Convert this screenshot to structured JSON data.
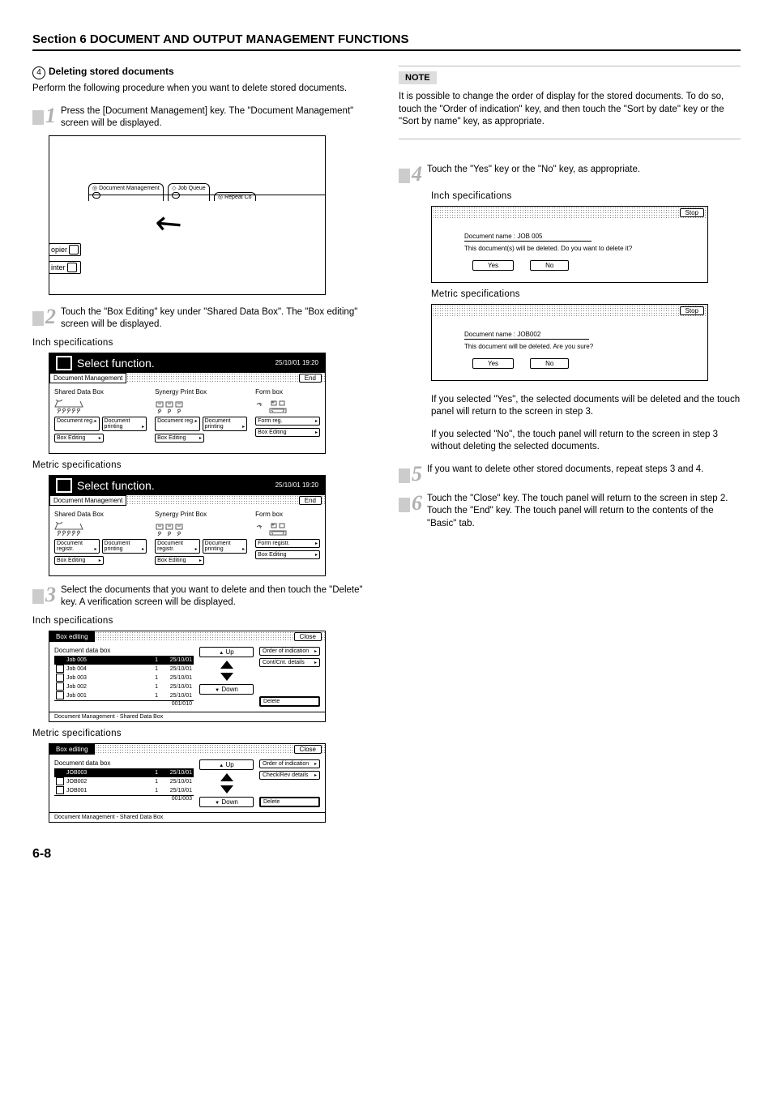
{
  "section_title": "Section 6  DOCUMENT AND OUTPUT MANAGEMENT FUNCTIONS",
  "circled_num": "4",
  "sub_heading": "Deleting stored documents",
  "intro": "Perform the following procedure when you want to delete stored documents.",
  "steps": {
    "s1": "Press the [Document Management] key. The \"Document Management\" screen will be displayed.",
    "s2": "Touch the \"Box Editing\" key under \"Shared Data Box\". The \"Box editing\" screen will be displayed.",
    "s3": "Select the documents that you want to delete and then touch the \"Delete\" key. A verification screen will be displayed.",
    "s4": "Touch the \"Yes\" key or the \"No\" key, as appropriate.",
    "s4b1": "If you selected \"Yes\", the selected documents will be deleted and the touch panel will return to the screen in step 3.",
    "s4b2": "If you selected \"No\", the touch panel will return to the screen in step 3 without deleting the selected documents.",
    "s5": "If you want to delete other stored documents, repeat steps 3 and 4.",
    "s6a": "Touch the \"Close\" key. The touch panel will return to the screen in step 2.",
    "s6b": "Touch the \"End\" key. The touch panel will return to the contents of the \"Basic\" tab."
  },
  "note": {
    "label": "NOTE",
    "text": "It is possible to change the order of display for the stored documents. To do so, touch the \"Order of indication\" key, and then touch the \"Sort by date\" key or the \"Sort by name\" key, as appropriate."
  },
  "labels": {
    "inch": "Inch specifications",
    "metric": "Metric specifications",
    "inch_sp": "Inch  specifications"
  },
  "fig1": {
    "tabs": [
      "Document Management",
      "Job Queue",
      "Repeat Co"
    ],
    "left": [
      "opier",
      "inter"
    ]
  },
  "sf": {
    "title": "Select function.",
    "ts_inch": "25/10/01 19:20",
    "ts_metric": "25/10/01   19:20",
    "tab": "Document Management",
    "end": "End",
    "col1_hdr": "Shared Data Box",
    "col2_hdr": "Synergy Print Box",
    "col3_hdr": "Form box",
    "btns_inch": {
      "dreg": "Document reg.",
      "dprt": "Document printing",
      "bedit": "Box Editing",
      "freg": "Form reg."
    },
    "btns_metric": {
      "dreg": "Document registr.",
      "dprt": "Document printing",
      "bedit": "Box Editing",
      "freg": "Form registr."
    }
  },
  "be": {
    "title": "Box editing",
    "close": "Close",
    "list_hdr": "Document data box",
    "rows_inch": [
      {
        "name": "Job 005",
        "c": "1",
        "d": "25/10/01",
        "sel": true
      },
      {
        "name": "Job 004",
        "c": "1",
        "d": "25/10/01"
      },
      {
        "name": "Job 003",
        "c": "1",
        "d": "25/10/01"
      },
      {
        "name": "Job 002",
        "c": "1",
        "d": "25/10/01"
      },
      {
        "name": "Job 001",
        "c": "1",
        "d": "25/10/01"
      }
    ],
    "foot_inch": "001/010",
    "rows_metric": [
      {
        "name": "JOB003",
        "c": "1",
        "d": "25/10/01",
        "sel": true
      },
      {
        "name": "JOB002",
        "c": "1",
        "d": "25/10/01"
      },
      {
        "name": "JOB001",
        "c": "1",
        "d": "25/10/01"
      }
    ],
    "foot_metric": "001/003",
    "up": "Up",
    "down": "Down",
    "order": "Order of indication",
    "cont": "Cont/Cnt. details",
    "check": "Check/Rev details",
    "delete": "Delete",
    "bottom": "Document Management - Shared Data Box"
  },
  "cf": {
    "stop": "Stop",
    "inch_name": "Document name : JOB 005",
    "inch_msg": "This document(s) will be deleted. Do you want to delete it?",
    "metric_name": "Document name : JOB002",
    "metric_msg": "This document will be deleted. Are you sure?",
    "yes": "Yes",
    "no": "No"
  },
  "page_num": "6-8"
}
